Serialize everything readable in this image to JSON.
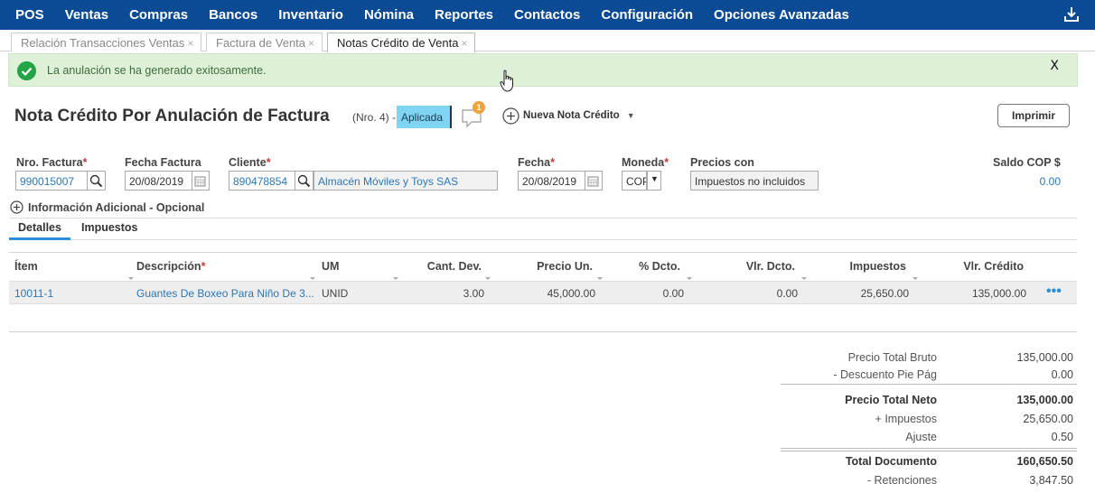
{
  "nav": {
    "items": [
      "POS",
      "Ventas",
      "Compras",
      "Bancos",
      "Inventario",
      "Nómina",
      "Reportes",
      "Contactos",
      "Configuración",
      "Opciones Avanzadas"
    ],
    "bg_color": "#0b4a94"
  },
  "tabs": [
    {
      "label": "Relación Transacciones Ventas",
      "close": "×"
    },
    {
      "label": "Factura de Venta",
      "close": "×"
    },
    {
      "label": "Notas Crédito de Venta",
      "close": "×"
    }
  ],
  "alert": {
    "message": "La anulación se ha generado exitosamente.",
    "close_label": "X",
    "color": "#dff0d8"
  },
  "header": {
    "title": "Nota Crédito Por Anulación de Factura",
    "doc_number": "(Nro. 4)",
    "separator": "-",
    "status": "Aplicada",
    "comment_count": "1",
    "new_button": "Nueva Nota Crédito",
    "print_button": "Imprimir"
  },
  "form": {
    "factura_label": "Nro. Factura",
    "factura_value": "990015007",
    "fecha_factura_label": "Fecha Factura",
    "fecha_factura_value": "20/08/2019",
    "cliente_label": "Cliente",
    "cliente_id": "890478854",
    "cliente_name": "Almacén Móviles y Toys SAS",
    "fecha_label": "Fecha",
    "fecha_value": "20/08/2019",
    "moneda_label": "Moneda",
    "moneda_value": "COP",
    "precios_label": "Precios con",
    "precios_value": "Impuestos no incluidos",
    "saldo_label": "Saldo COP $",
    "saldo_value": "0.00",
    "required_mark": "*"
  },
  "info_adicional": "Información Adicional - Opcional",
  "subtabs": [
    "Detalles",
    "Impuestos"
  ],
  "grid": {
    "columns": [
      "Ítem",
      "Descripción",
      "UM",
      "Cant. Dev.",
      "Precio Un.",
      "% Dcto.",
      "Vlr. Dcto.",
      "Impuestos",
      "Vlr. Crédito"
    ],
    "rows": [
      {
        "item": "10011-1",
        "descripcion": "Guantes De Boxeo Para Niño De 3...",
        "um": "UNID",
        "cant": "3.00",
        "precio": "45,000.00",
        "pct_dcto": "0.00",
        "vlr_dcto": "0.00",
        "impuestos": "25,650.00",
        "vlr_credito": "135,000.00"
      }
    ]
  },
  "totals": {
    "precio_bruto_label": "Precio Total Bruto",
    "precio_bruto": "135,000.00",
    "descuento_label": "- Descuento Pie Pág",
    "descuento": "0.00",
    "precio_neto_label": "Precio Total Neto",
    "precio_neto": "135,000.00",
    "impuestos_label": "+ Impuestos",
    "impuestos": "25,650.00",
    "ajuste_label": "Ajuste",
    "ajuste": "0.50",
    "total_label": "Total Documento",
    "total": "160,650.50",
    "retenciones_label": "- Retenciones",
    "retenciones": "3,847.50"
  }
}
